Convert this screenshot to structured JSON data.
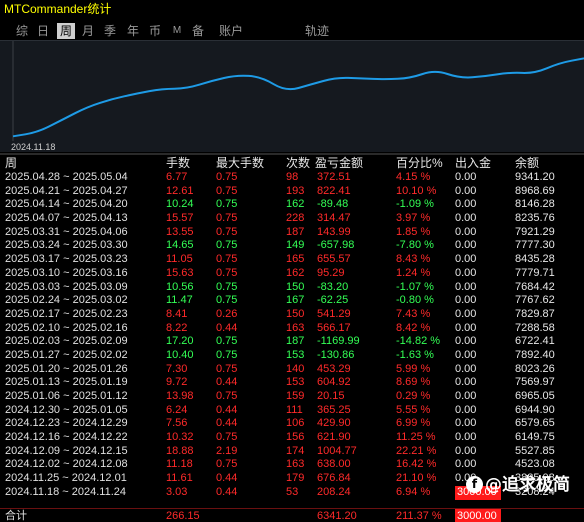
{
  "app": {
    "title": "MTCommander统计"
  },
  "tabs": [
    {
      "label": "综",
      "active": false
    },
    {
      "label": "日",
      "active": false
    },
    {
      "label": "周",
      "active": true
    },
    {
      "label": "月",
      "active": false
    },
    {
      "label": "季",
      "active": false
    },
    {
      "label": "年",
      "active": false
    },
    {
      "label": "币",
      "active": false
    },
    {
      "label": "M",
      "active": false
    },
    {
      "label": "备",
      "active": false
    },
    {
      "label": "账户",
      "active": false
    },
    {
      "label": "轨迹",
      "active": false
    }
  ],
  "equity_chart": {
    "start_date_label": "2024.11.18",
    "line_color": "#1e9be6",
    "balances": [
      3208.24,
      3527.85,
      4523.08,
      5527.85,
      6149.75,
      6579.65,
      6944.9,
      6965.05,
      7569.97,
      8023.26,
      7892.4,
      6722.41,
      7288.58,
      7829.87,
      7767.62,
      7684.42,
      7779.71,
      8435.28,
      7777.3,
      7921.29,
      8235.76,
      8146.28,
      8968.69,
      9341.2
    ]
  },
  "table": {
    "headers": {
      "period": "周",
      "lots": "手数",
      "max_lots": "最大手数",
      "trades": "次数",
      "pnl": "盈亏金额",
      "pct": "百分比%",
      "deposit": "出入金",
      "balance": "余额"
    },
    "rows": [
      {
        "period": "2025.04.28 ~ 2025.05.04",
        "lots": "6.77",
        "max_lots": "0.75",
        "trades": "98",
        "pnl": "372.51",
        "pct": "4.15 %",
        "deposit": "0.00",
        "balance": "9341.20",
        "sign": "loss"
      },
      {
        "period": "2025.04.21 ~ 2025.04.27",
        "lots": "12.61",
        "max_lots": "0.75",
        "trades": "193",
        "pnl": "822.41",
        "pct": "10.10 %",
        "deposit": "0.00",
        "balance": "8968.69",
        "sign": "loss"
      },
      {
        "period": "2025.04.14 ~ 2025.04.20",
        "lots": "10.24",
        "max_lots": "0.75",
        "trades": "162",
        "pnl": "-89.48",
        "pct": "-1.09 %",
        "deposit": "0.00",
        "balance": "8146.28",
        "sign": "gain"
      },
      {
        "period": "2025.04.07 ~ 2025.04.13",
        "lots": "15.57",
        "max_lots": "0.75",
        "trades": "228",
        "pnl": "314.47",
        "pct": "3.97 %",
        "deposit": "0.00",
        "balance": "8235.76",
        "sign": "loss"
      },
      {
        "period": "2025.03.31 ~ 2025.04.06",
        "lots": "13.55",
        "max_lots": "0.75",
        "trades": "187",
        "pnl": "143.99",
        "pct": "1.85 %",
        "deposit": "0.00",
        "balance": "7921.29",
        "sign": "loss"
      },
      {
        "period": "2025.03.24 ~ 2025.03.30",
        "lots": "14.65",
        "max_lots": "0.75",
        "trades": "149",
        "pnl": "-657.98",
        "pct": "-7.80 %",
        "deposit": "0.00",
        "balance": "7777.30",
        "sign": "gain"
      },
      {
        "period": "2025.03.17 ~ 2025.03.23",
        "lots": "11.05",
        "max_lots": "0.75",
        "trades": "165",
        "pnl": "655.57",
        "pct": "8.43 %",
        "deposit": "0.00",
        "balance": "8435.28",
        "sign": "loss"
      },
      {
        "period": "2025.03.10 ~ 2025.03.16",
        "lots": "15.63",
        "max_lots": "0.75",
        "trades": "162",
        "pnl": "95.29",
        "pct": "1.24 %",
        "deposit": "0.00",
        "balance": "7779.71",
        "sign": "loss"
      },
      {
        "period": "2025.03.03 ~ 2025.03.09",
        "lots": "10.56",
        "max_lots": "0.75",
        "trades": "150",
        "pnl": "-83.20",
        "pct": "-1.07 %",
        "deposit": "0.00",
        "balance": "7684.42",
        "sign": "gain"
      },
      {
        "period": "2025.02.24 ~ 2025.03.02",
        "lots": "11.47",
        "max_lots": "0.75",
        "trades": "167",
        "pnl": "-62.25",
        "pct": "-0.80 %",
        "deposit": "0.00",
        "balance": "7767.62",
        "sign": "gain"
      },
      {
        "period": "2025.02.17 ~ 2025.02.23",
        "lots": "8.41",
        "max_lots": "0.26",
        "trades": "150",
        "pnl": "541.29",
        "pct": "7.43 %",
        "deposit": "0.00",
        "balance": "7829.87",
        "sign": "loss"
      },
      {
        "period": "2025.02.10 ~ 2025.02.16",
        "lots": "8.22",
        "max_lots": "0.44",
        "trades": "163",
        "pnl": "566.17",
        "pct": "8.42 %",
        "deposit": "0.00",
        "balance": "7288.58",
        "sign": "loss"
      },
      {
        "period": "2025.02.03 ~ 2025.02.09",
        "lots": "17.20",
        "max_lots": "0.75",
        "trades": "187",
        "pnl": "-1169.99",
        "pct": "-14.82 %",
        "deposit": "0.00",
        "balance": "6722.41",
        "sign": "gain"
      },
      {
        "period": "2025.01.27 ~ 2025.02.02",
        "lots": "10.40",
        "max_lots": "0.75",
        "trades": "153",
        "pnl": "-130.86",
        "pct": "-1.63 %",
        "deposit": "0.00",
        "balance": "7892.40",
        "sign": "gain"
      },
      {
        "period": "2025.01.20 ~ 2025.01.26",
        "lots": "7.30",
        "max_lots": "0.75",
        "trades": "140",
        "pnl": "453.29",
        "pct": "5.99 %",
        "deposit": "0.00",
        "balance": "8023.26",
        "sign": "loss"
      },
      {
        "period": "2025.01.13 ~ 2025.01.19",
        "lots": "9.72",
        "max_lots": "0.44",
        "trades": "153",
        "pnl": "604.92",
        "pct": "8.69 %",
        "deposit": "0.00",
        "balance": "7569.97",
        "sign": "loss"
      },
      {
        "period": "2025.01.06 ~ 2025.01.12",
        "lots": "13.98",
        "max_lots": "0.75",
        "trades": "159",
        "pnl": "20.15",
        "pct": "0.29 %",
        "deposit": "0.00",
        "balance": "6965.05",
        "sign": "loss"
      },
      {
        "period": "2024.12.30 ~ 2025.01.05",
        "lots": "6.24",
        "max_lots": "0.44",
        "trades": "111",
        "pnl": "365.25",
        "pct": "5.55 %",
        "deposit": "0.00",
        "balance": "6944.90",
        "sign": "loss"
      },
      {
        "period": "2024.12.23 ~ 2024.12.29",
        "lots": "7.56",
        "max_lots": "0.44",
        "trades": "106",
        "pnl": "429.90",
        "pct": "6.99 %",
        "deposit": "0.00",
        "balance": "6579.65",
        "sign": "loss"
      },
      {
        "period": "2024.12.16 ~ 2024.12.22",
        "lots": "10.32",
        "max_lots": "0.75",
        "trades": "156",
        "pnl": "621.90",
        "pct": "11.25 %",
        "deposit": "0.00",
        "balance": "6149.75",
        "sign": "loss"
      },
      {
        "period": "2024.12.09 ~ 2024.12.15",
        "lots": "18.88",
        "max_lots": "2.19",
        "trades": "174",
        "pnl": "1004.77",
        "pct": "22.21 %",
        "deposit": "0.00",
        "balance": "5527.85",
        "sign": "loss"
      },
      {
        "period": "2024.12.02 ~ 2024.12.08",
        "lots": "11.18",
        "max_lots": "0.75",
        "trades": "163",
        "pnl": "638.00",
        "pct": "16.42 %",
        "deposit": "0.00",
        "balance": "4523.08",
        "sign": "loss"
      },
      {
        "period": "2024.11.25 ~ 2024.12.01",
        "lots": "11.61",
        "max_lots": "0.44",
        "trades": "179",
        "pnl": "676.84",
        "pct": "21.10 %",
        "deposit": "0.00",
        "balance": "3885.08",
        "sign": "loss"
      },
      {
        "period": "2024.11.18 ~ 2024.11.24",
        "lots": "3.03",
        "max_lots": "0.44",
        "trades": "53",
        "pnl": "208.24",
        "pct": "6.94 %",
        "deposit": "3000.00",
        "balance": "3208.24",
        "sign": "loss",
        "highlight": true
      }
    ],
    "total": {
      "label": "合计",
      "lots": "266.15",
      "pnl": "6341.20",
      "pct": "211.37 %",
      "deposit": "3000.00"
    }
  },
  "watermark": {
    "logo_glyph": "f",
    "text": "@追求极简"
  }
}
